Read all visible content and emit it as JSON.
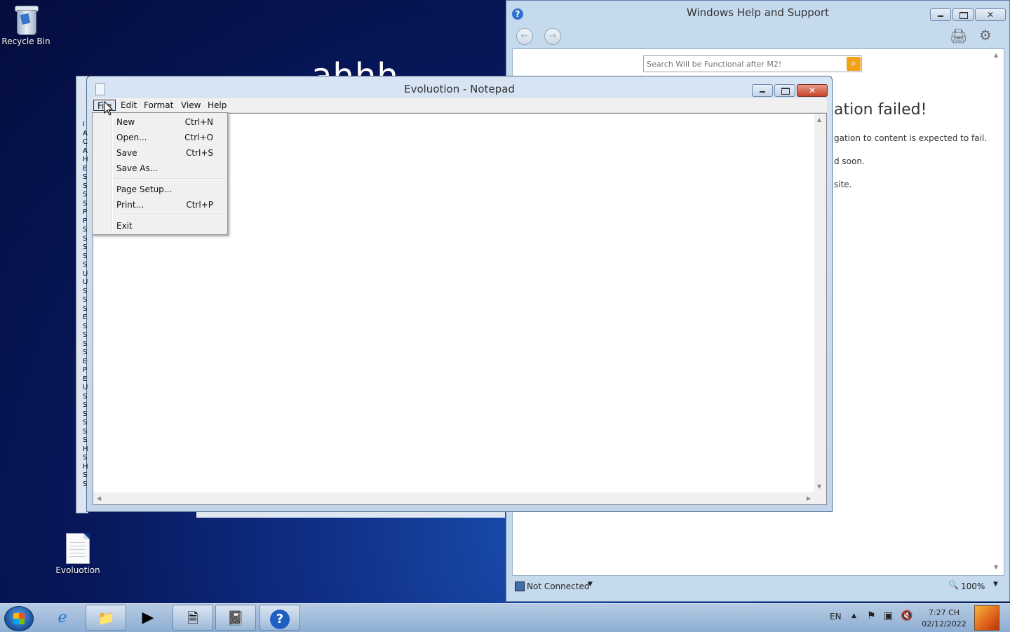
{
  "desktop": {
    "icons": [
      {
        "label": "Recycle Bin"
      },
      {
        "label": "Evoluotion"
      }
    ],
    "background_text": "ahhh"
  },
  "help_window": {
    "title": "Windows Help and Support",
    "search_placeholder": "Search Will be Functional after M2!",
    "heading_partial": "ation failed!",
    "paragraphs": [
      "gation to content is expected to fail.",
      "d soon.",
      "site."
    ],
    "status": "Not Connected",
    "zoom": "100%"
  },
  "notepad": {
    "title": "Evoluotion - Notepad",
    "menu": [
      "File",
      "Edit",
      "Format",
      "View",
      "Help"
    ],
    "side_strip_letters": [
      "I",
      "A",
      "C",
      "A",
      "H",
      "E",
      "S",
      "S",
      "S",
      "S",
      "P",
      "P",
      "S",
      "S",
      "S",
      "S",
      "S",
      "U",
      "U",
      "S",
      "S",
      "S",
      "E",
      "S",
      "S",
      "S",
      "S",
      "E",
      "P",
      "E",
      "U",
      "S",
      "S",
      "S",
      "S",
      "S",
      "S",
      "H",
      "S",
      "H",
      "S",
      "S",
      "P"
    ]
  },
  "file_menu": {
    "items": [
      {
        "label": "New",
        "shortcut": "Ctrl+N"
      },
      {
        "label": "Open...",
        "shortcut": "Ctrl+O"
      },
      {
        "label": "Save",
        "shortcut": "Ctrl+S"
      },
      {
        "label": "Save As...",
        "shortcut": ""
      },
      {
        "label": "Page Setup...",
        "shortcut": ""
      },
      {
        "label": "Print...",
        "shortcut": "Ctrl+P"
      },
      {
        "label": "Exit",
        "shortcut": ""
      }
    ]
  },
  "taskbar": {
    "language": "EN",
    "time": "7:27 CH",
    "date": "02/12/2022"
  },
  "colors": {
    "desktop_bg": "#0b2270",
    "window_frame": "#c6daee",
    "close_red": "#c7452b"
  }
}
